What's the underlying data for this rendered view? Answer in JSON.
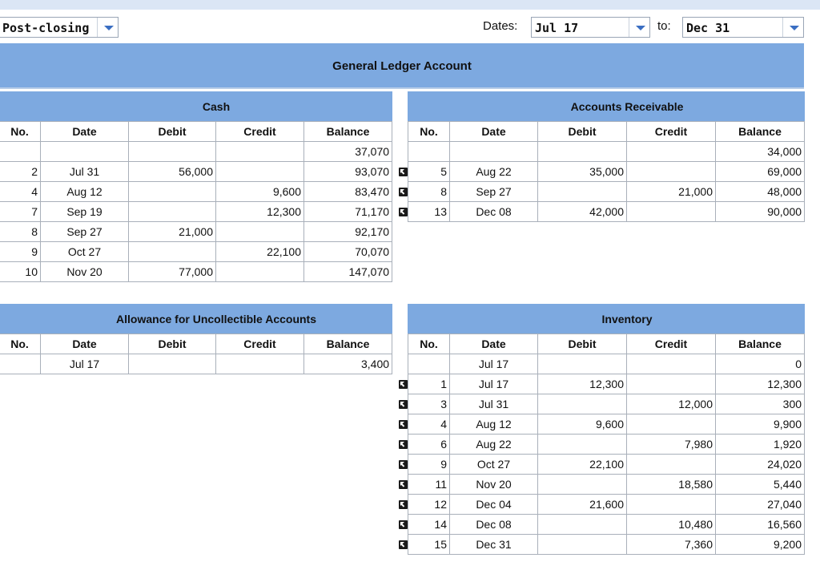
{
  "report_select": {
    "value": "Post-closing"
  },
  "dates": {
    "label": "Dates:",
    "from": "Jul 17",
    "to_label": "to:",
    "to": "Dec 31"
  },
  "header": {
    "title": "General Ledger Account"
  },
  "columns": {
    "no": "No.",
    "date": "Date",
    "debit": "Debit",
    "credit": "Credit",
    "balance": "Balance"
  },
  "accounts": {
    "cash": {
      "title": "Cash",
      "rows": [
        {
          "no": "",
          "date": "",
          "debit": "",
          "credit": "",
          "balance": "37,070"
        },
        {
          "no": "2",
          "date": "Jul 31",
          "debit": "56,000",
          "credit": "",
          "balance": "93,070"
        },
        {
          "no": "4",
          "date": "Aug 12",
          "debit": "",
          "credit": "9,600",
          "balance": "83,470"
        },
        {
          "no": "7",
          "date": "Sep 19",
          "debit": "",
          "credit": "12,300",
          "balance": "71,170"
        },
        {
          "no": "8",
          "date": "Sep 27",
          "debit": "21,000",
          "credit": "",
          "balance": "92,170"
        },
        {
          "no": "9",
          "date": "Oct 27",
          "debit": "",
          "credit": "22,100",
          "balance": "70,070"
        },
        {
          "no": "10",
          "date": "Nov 20",
          "debit": "77,000",
          "credit": "",
          "balance": "147,070"
        }
      ]
    },
    "accounts_receivable": {
      "title": "Accounts Receivable",
      "rows": [
        {
          "no": "",
          "date": "",
          "debit": "",
          "credit": "",
          "balance": "34,000"
        },
        {
          "no": "5",
          "date": "Aug 22",
          "debit": "35,000",
          "credit": "",
          "balance": "69,000"
        },
        {
          "no": "8",
          "date": "Sep 27",
          "debit": "",
          "credit": "21,000",
          "balance": "48,000"
        },
        {
          "no": "13",
          "date": "Dec 08",
          "debit": "42,000",
          "credit": "",
          "balance": "90,000"
        }
      ]
    },
    "allowance": {
      "title": "Allowance for Uncollectible Accounts",
      "rows": [
        {
          "no": "",
          "date": "Jul 17",
          "debit": "",
          "credit": "",
          "balance": "3,400"
        }
      ]
    },
    "inventory": {
      "title": "Inventory",
      "rows": [
        {
          "no": "",
          "date": "Jul 17",
          "debit": "",
          "credit": "",
          "balance": "0"
        },
        {
          "no": "1",
          "date": "Jul 17",
          "debit": "12,300",
          "credit": "",
          "balance": "12,300"
        },
        {
          "no": "3",
          "date": "Jul 31",
          "debit": "",
          "credit": "12,000",
          "balance": "300"
        },
        {
          "no": "4",
          "date": "Aug 12",
          "debit": "9,600",
          "credit": "",
          "balance": "9,900"
        },
        {
          "no": "6",
          "date": "Aug 22",
          "debit": "",
          "credit": "7,980",
          "balance": "1,920"
        },
        {
          "no": "9",
          "date": "Oct 27",
          "debit": "22,100",
          "credit": "",
          "balance": "24,020"
        },
        {
          "no": "11",
          "date": "Nov 20",
          "debit": "",
          "credit": "18,580",
          "balance": "5,440"
        },
        {
          "no": "12",
          "date": "Dec 04",
          "debit": "21,600",
          "credit": "",
          "balance": "27,040"
        },
        {
          "no": "14",
          "date": "Dec 08",
          "debit": "",
          "credit": "10,480",
          "balance": "16,560"
        },
        {
          "no": "15",
          "date": "Dec 31",
          "debit": "",
          "credit": "7,360",
          "balance": "9,200"
        }
      ]
    }
  }
}
